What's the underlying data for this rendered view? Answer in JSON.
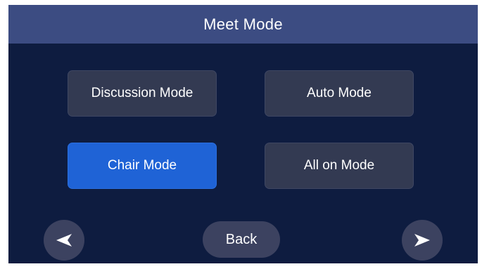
{
  "header": {
    "title": "Meet Mode"
  },
  "modes": [
    {
      "label": "Discussion Mode",
      "active": false
    },
    {
      "label": "Auto Mode",
      "active": false
    },
    {
      "label": "Chair Mode",
      "active": true
    },
    {
      "label": "All on Mode",
      "active": false
    }
  ],
  "nav": {
    "back_label": "Back",
    "prev_icon": "arrow-left-icon",
    "next_icon": "arrow-right-icon"
  },
  "colors": {
    "background": "#0e1c40",
    "header": "#3c4c82",
    "button": "#333a52",
    "active_button": "#1f63d6",
    "nav_button": "#3c4260"
  }
}
